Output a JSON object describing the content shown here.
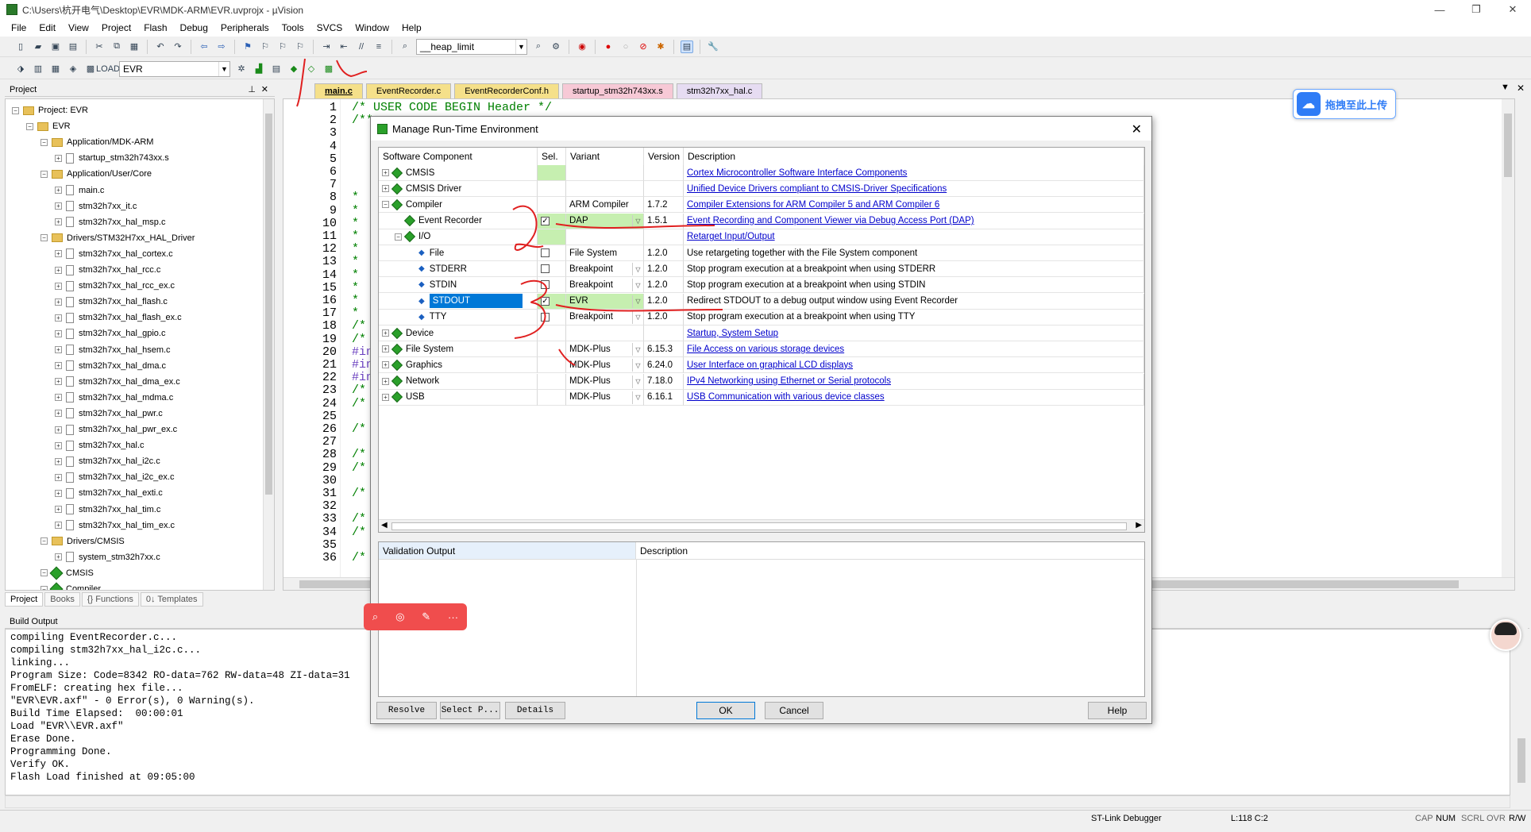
{
  "window": {
    "title": "C:\\Users\\杭开电气\\Desktop\\EVR\\MDK-ARM\\EVR.uvprojx - µVision"
  },
  "menu": [
    "File",
    "Edit",
    "View",
    "Project",
    "Flash",
    "Debug",
    "Peripherals",
    "Tools",
    "SVCS",
    "Window",
    "Help"
  ],
  "toolbar": {
    "heap_combo": "__heap_limit",
    "target_combo": "EVR"
  },
  "project_panel": {
    "title": "Project",
    "items": [
      {
        "label": "Project: EVR",
        "level": 0,
        "type": "root"
      },
      {
        "label": "EVR",
        "level": 1,
        "type": "folder"
      },
      {
        "label": "Application/MDK-ARM",
        "level": 2,
        "type": "folder"
      },
      {
        "label": "startup_stm32h743xx.s",
        "level": 3,
        "type": "file"
      },
      {
        "label": "Application/User/Core",
        "level": 2,
        "type": "folder"
      },
      {
        "label": "main.c",
        "level": 3,
        "type": "file"
      },
      {
        "label": "stm32h7xx_it.c",
        "level": 3,
        "type": "file"
      },
      {
        "label": "stm32h7xx_hal_msp.c",
        "level": 3,
        "type": "file"
      },
      {
        "label": "Drivers/STM32H7xx_HAL_Driver",
        "level": 2,
        "type": "folder"
      },
      {
        "label": "stm32h7xx_hal_cortex.c",
        "level": 3,
        "type": "file"
      },
      {
        "label": "stm32h7xx_hal_rcc.c",
        "level": 3,
        "type": "file"
      },
      {
        "label": "stm32h7xx_hal_rcc_ex.c",
        "level": 3,
        "type": "file"
      },
      {
        "label": "stm32h7xx_hal_flash.c",
        "level": 3,
        "type": "file"
      },
      {
        "label": "stm32h7xx_hal_flash_ex.c",
        "level": 3,
        "type": "file"
      },
      {
        "label": "stm32h7xx_hal_gpio.c",
        "level": 3,
        "type": "file"
      },
      {
        "label": "stm32h7xx_hal_hsem.c",
        "level": 3,
        "type": "file"
      },
      {
        "label": "stm32h7xx_hal_dma.c",
        "level": 3,
        "type": "file"
      },
      {
        "label": "stm32h7xx_hal_dma_ex.c",
        "level": 3,
        "type": "file"
      },
      {
        "label": "stm32h7xx_hal_mdma.c",
        "level": 3,
        "type": "file"
      },
      {
        "label": "stm32h7xx_hal_pwr.c",
        "level": 3,
        "type": "file"
      },
      {
        "label": "stm32h7xx_hal_pwr_ex.c",
        "level": 3,
        "type": "file"
      },
      {
        "label": "stm32h7xx_hal.c",
        "level": 3,
        "type": "file"
      },
      {
        "label": "stm32h7xx_hal_i2c.c",
        "level": 3,
        "type": "file"
      },
      {
        "label": "stm32h7xx_hal_i2c_ex.c",
        "level": 3,
        "type": "file"
      },
      {
        "label": "stm32h7xx_hal_exti.c",
        "level": 3,
        "type": "file"
      },
      {
        "label": "stm32h7xx_hal_tim.c",
        "level": 3,
        "type": "file"
      },
      {
        "label": "stm32h7xx_hal_tim_ex.c",
        "level": 3,
        "type": "file"
      },
      {
        "label": "Drivers/CMSIS",
        "level": 2,
        "type": "folder"
      },
      {
        "label": "system_stm32h7xx.c",
        "level": 3,
        "type": "file"
      },
      {
        "label": "CMSIS",
        "level": 2,
        "type": "gem"
      },
      {
        "label": "Compiler",
        "level": 2,
        "type": "gem"
      }
    ],
    "tabs": [
      "Project",
      "Books",
      "{} Functions",
      "0↓ Templates"
    ]
  },
  "file_tabs": [
    "main.c",
    "EventRecorder.c",
    "EventRecorderConf.h",
    "startup_stm32h743xx.s",
    "stm32h7xx_hal.c"
  ],
  "editor": {
    "line_numbers": [
      "1",
      "2",
      "3",
      "4",
      "5",
      "6",
      "7",
      "8",
      "9",
      "10",
      "11",
      "12",
      "13",
      "14",
      "15",
      "16",
      "17",
      "18",
      "19",
      "20",
      "21",
      "22",
      "23",
      "24",
      "25",
      "26",
      "27",
      "28",
      "29",
      "30",
      "31",
      "32",
      "33",
      "34",
      "35",
      "36"
    ],
    "code_lines": [
      "/* USER CODE BEGIN Header */",
      "/**",
      "",
      "",
      "",
      "",
      "",
      "*",
      "*",
      "*",
      "*",
      "*",
      "*",
      "*",
      "*",
      "*",
      "*",
      "/*",
      "/*",
      "#in",
      "#in",
      "#in",
      "/*",
      "/*",
      "",
      "/*",
      "",
      "/*",
      "/*",
      "",
      "/*",
      "",
      "/*",
      "/*",
      "",
      "/*"
    ]
  },
  "dialog": {
    "title": "Manage Run-Time Environment",
    "headers": [
      "Software Component",
      "Sel.",
      "Variant",
      "Version",
      "Description"
    ],
    "rows": [
      {
        "name": "CMSIS",
        "indent": 0,
        "exp": "+",
        "sel": "green",
        "variant": "",
        "version": "",
        "desc": "Cortex Microcontroller Software Interface Components",
        "link": true
      },
      {
        "name": "CMSIS Driver",
        "indent": 0,
        "exp": "+",
        "sel": "",
        "variant": "",
        "version": "",
        "desc": "Unified Device Drivers compliant to CMSIS-Driver Specifications",
        "link": true
      },
      {
        "name": "Compiler",
        "indent": 0,
        "exp": "-",
        "sel": "",
        "variant": "ARM Compiler",
        "version": "1.7.2",
        "desc": "Compiler Extensions for ARM Compiler 5 and ARM Compiler 6",
        "link": true
      },
      {
        "name": "Event Recorder",
        "indent": 1,
        "exp": "",
        "sel": "check",
        "variant": "DAP",
        "dd": true,
        "version": "1.5.1",
        "desc": "Event Recording and Component Viewer via Debug Access Port (DAP)",
        "link": true
      },
      {
        "name": "I/O",
        "indent": 1,
        "exp": "-",
        "sel": "green",
        "variant": "",
        "version": "",
        "desc": "Retarget Input/Output",
        "link": true
      },
      {
        "name": "File",
        "indent": 2,
        "exp": "",
        "sel": "box",
        "variant": "File System",
        "version": "1.2.0",
        "desc": "Use retargeting together with the File System component",
        "link": false
      },
      {
        "name": "STDERR",
        "indent": 2,
        "exp": "",
        "sel": "box",
        "variant": "Breakpoint",
        "dd": true,
        "version": "1.2.0",
        "desc": "Stop program execution at a breakpoint when using STDERR",
        "link": false
      },
      {
        "name": "STDIN",
        "indent": 2,
        "exp": "",
        "sel": "box",
        "variant": "Breakpoint",
        "dd": true,
        "version": "1.2.0",
        "desc": "Stop program execution at a breakpoint when using STDIN",
        "link": false
      },
      {
        "name": "STDOUT",
        "indent": 2,
        "exp": "",
        "sel": "check",
        "variant": "EVR",
        "dd": true,
        "version": "1.2.0",
        "desc": "Redirect STDOUT to a debug output window using Event Recorder",
        "link": false,
        "selected": true
      },
      {
        "name": "TTY",
        "indent": 2,
        "exp": "",
        "sel": "box",
        "variant": "Breakpoint",
        "dd": true,
        "version": "1.2.0",
        "desc": "Stop program execution at a breakpoint when using TTY",
        "link": false
      },
      {
        "name": "Device",
        "indent": 0,
        "exp": "+",
        "sel": "",
        "variant": "",
        "version": "",
        "desc": "Startup, System Setup",
        "link": true
      },
      {
        "name": "File System",
        "indent": 0,
        "exp": "+",
        "sel": "",
        "variant": "MDK-Plus",
        "dd": true,
        "version": "6.15.3",
        "desc": "File Access on various storage devices",
        "link": true
      },
      {
        "name": "Graphics",
        "indent": 0,
        "exp": "+",
        "sel": "",
        "variant": "MDK-Plus",
        "dd": true,
        "version": "6.24.0",
        "desc": "User Interface on graphical LCD displays",
        "link": true
      },
      {
        "name": "Network",
        "indent": 0,
        "exp": "+",
        "sel": "",
        "variant": "MDK-Plus",
        "dd": true,
        "version": "7.18.0",
        "desc": "IPv4 Networking using Ethernet or Serial protocols",
        "link": true
      },
      {
        "name": "USB",
        "indent": 0,
        "exp": "+",
        "sel": "",
        "variant": "MDK-Plus",
        "dd": true,
        "version": "6.16.1",
        "desc": "USB Communication with various device classes",
        "link": true
      }
    ],
    "validation": {
      "col1": "Validation Output",
      "col2": "Description"
    },
    "buttons": {
      "resolve": "Resolve",
      "select": "Select P...",
      "details": "Details",
      "ok": "OK",
      "cancel": "Cancel",
      "help": "Help"
    }
  },
  "build_output": {
    "title": "Build Output",
    "text": "compiling EventRecorder.c...\ncompiling stm32h7xx_hal_i2c.c...\nlinking...\nProgram Size: Code=8342 RO-data=762 RW-data=48 ZI-data=31\nFromELF: creating hex file...\n\"EVR\\EVR.axf\" - 0 Error(s), 0 Warning(s).\nBuild Time Elapsed:  00:00:01\nLoad \"EVR\\\\EVR.axf\"\nErase Done.\nProgramming Done.\nVerify OK.\nFlash Load finished at 09:05:00"
  },
  "status": {
    "debugger": "ST-Link Debugger",
    "position": "L:118 C:2",
    "caps": "CAP",
    "num": "NUM",
    "scrl": "SCRL",
    "ovr": "OVR",
    "rw": "R/W"
  },
  "overlay": {
    "upload_label": "拖拽至此上传"
  },
  "colors": {
    "accent": "#0078d7",
    "selection": "#0078d7",
    "link": "#0000cc",
    "green_sel": "#c6efb0",
    "annotation": "#e02020"
  }
}
